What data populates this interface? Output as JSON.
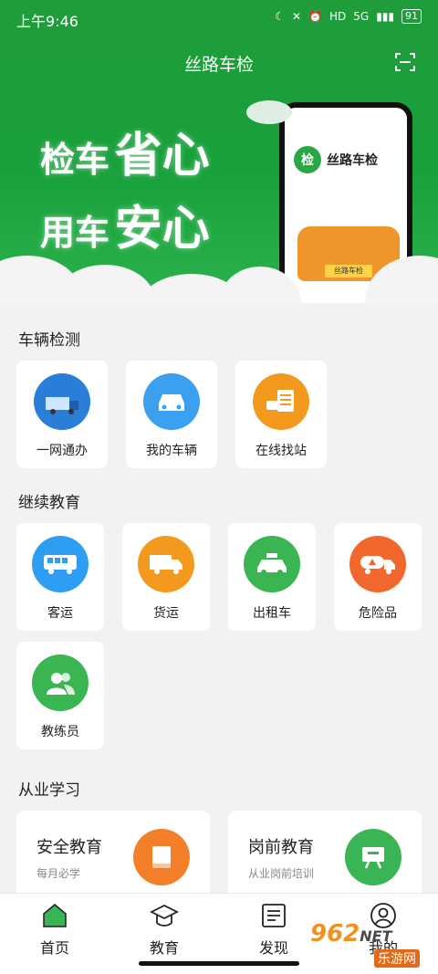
{
  "status_bar": {
    "time": "上午9:46",
    "network": "5G",
    "battery": "91"
  },
  "header": {
    "title": "丝路车检"
  },
  "banner": {
    "slogan_line1": [
      "检车",
      "省心"
    ],
    "slogan_line2": [
      "用车",
      "安心"
    ],
    "phone_logo_text": "丝路车检",
    "phone_badge": "检",
    "phone_plate": "丝路车检"
  },
  "vehicle_inspection": {
    "title": "车辆检测",
    "items": [
      {
        "label": "一网通办",
        "color": "#2a7ed8"
      },
      {
        "label": "我的车辆",
        "color": "#3aa0ef"
      },
      {
        "label": "在线找站",
        "color": "#f39a1e"
      }
    ]
  },
  "continuing_education": {
    "title": "继续教育",
    "items": [
      {
        "label": "客运",
        "color": "#2e9ef2"
      },
      {
        "label": "货运",
        "color": "#f39a1e"
      },
      {
        "label": "出租车",
        "color": "#39b552"
      },
      {
        "label": "危险品",
        "color": "#f2672b"
      },
      {
        "label": "教练员",
        "color": "#39b552"
      }
    ]
  },
  "employment_learning": {
    "title": "从业学习",
    "items": [
      {
        "title": "安全教育",
        "subtitle": "每月必学",
        "color": "#f37f2a"
      },
      {
        "title": "岗前教育",
        "subtitle": "从业岗前培训",
        "color": "#3ab555"
      }
    ]
  },
  "bottom_nav": {
    "items": [
      {
        "label": "首页"
      },
      {
        "label": "教育"
      },
      {
        "label": "发现"
      },
      {
        "label": "我的"
      }
    ]
  },
  "watermark": {
    "top": "962",
    "top_suffix": "NET",
    "bottom": "乐游网"
  }
}
